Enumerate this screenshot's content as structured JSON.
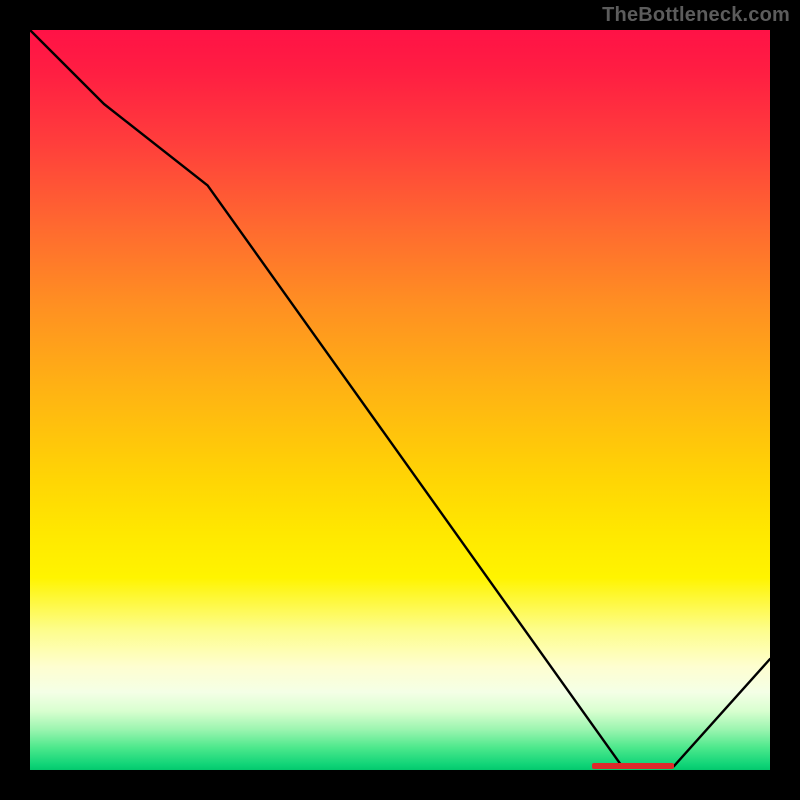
{
  "watermark": "TheBottleneck.com",
  "chart_data": {
    "type": "line",
    "title": "",
    "xlabel": "",
    "ylabel": "",
    "xlim": [
      0,
      100
    ],
    "ylim": [
      0,
      100
    ],
    "grid": false,
    "series": [
      {
        "name": "curve",
        "x": [
          0,
          10,
          24,
          80,
          87,
          100
        ],
        "y": [
          100,
          90,
          79,
          0.5,
          0.5,
          15
        ]
      }
    ],
    "markers": [
      {
        "name": "optimal-range",
        "x_start": 76,
        "x_end": 87,
        "y": 0.5
      }
    ],
    "background_gradient": {
      "top": "#ff1246",
      "mid": "#ffe800",
      "bottom": "#04c86d"
    }
  }
}
